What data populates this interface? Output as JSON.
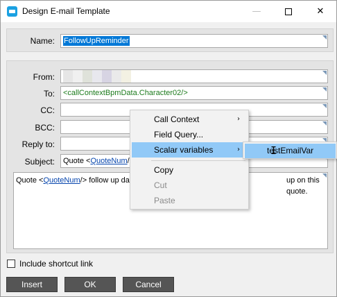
{
  "window": {
    "title": "Design E-mail Template",
    "min_glyph": "—",
    "close_glyph": "✕"
  },
  "form": {
    "name_label": "Name:",
    "name_value": "FollowUpReminder",
    "from_label": "From:",
    "from_chip_colors": [
      "#e6e6e6",
      "#f0f0f0",
      "#dfe2da",
      "#e8e8ee",
      "#d7d4e3",
      "#eaeaea",
      "#f3f1e3"
    ],
    "to_label": "To:",
    "to_value": "<callContextBpmData.Character02/>",
    "cc_label": "CC:",
    "bcc_label": "BCC:",
    "replyto_label": "Reply to:",
    "subject_label": "Subject:",
    "subject_prefix": "Quote <",
    "subject_link": "QuoteNum",
    "subject_suffix": "/>",
    "body_prefix": "Quote <",
    "body_link": "QuoteNum",
    "body_mid": "/> follow up dat",
    "body_tail": "up on this quote."
  },
  "footer": {
    "shortcut_label": "Include shortcut link",
    "insert_label": "Insert",
    "ok_label": "OK",
    "cancel_label": "Cancel"
  },
  "context_menu": {
    "items": [
      {
        "label": "Call Context",
        "arrow": "›"
      },
      {
        "label": "Field Query..."
      },
      {
        "label": "Scalar variables",
        "arrow": "›"
      },
      {
        "label": "Copy"
      },
      {
        "label": "Cut"
      },
      {
        "label": "Paste"
      }
    ]
  },
  "submenu": {
    "item": "testEmailVar",
    "cursor_glyph": "I"
  },
  "colors": {
    "highlight": "#91c9f7",
    "selection": "#0078d7",
    "button": "#555555",
    "title_icon": "#1ba1e2"
  }
}
